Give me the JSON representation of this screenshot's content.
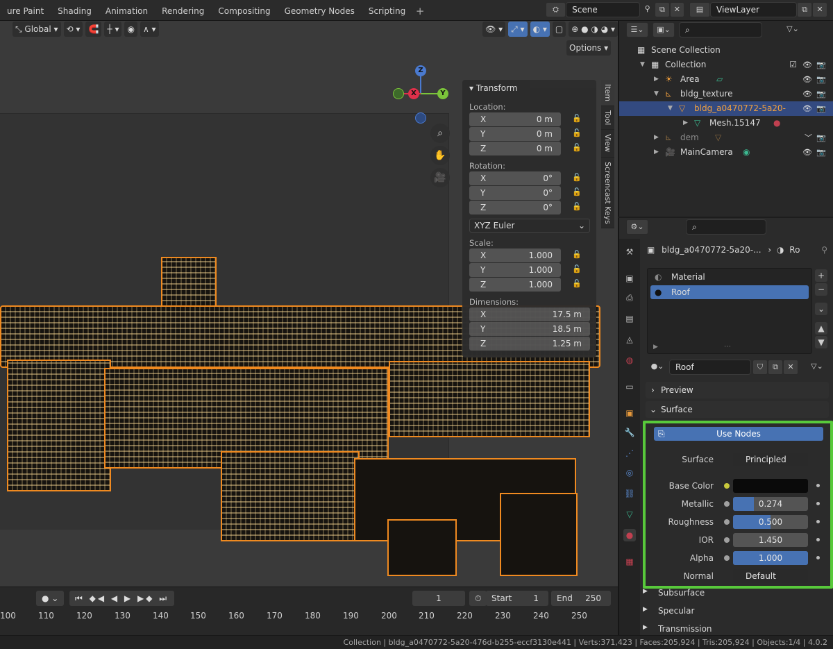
{
  "workspace_tabs": [
    "ure Paint",
    "Shading",
    "Animation",
    "Rendering",
    "Compositing",
    "Geometry Nodes",
    "Scripting"
  ],
  "scene": {
    "name": "Scene"
  },
  "view_layer": {
    "name": "ViewLayer"
  },
  "viewport": {
    "orientation": "Global",
    "options_label": "Options",
    "gizmo": {
      "z": "Z",
      "y": "Y",
      "x": "X"
    },
    "tabs": [
      "Item",
      "Tool",
      "View",
      "Screencast Keys"
    ]
  },
  "transform": {
    "title": "Transform",
    "location_label": "Location:",
    "location": [
      {
        "axis": "X",
        "value": "0 m"
      },
      {
        "axis": "Y",
        "value": "0 m"
      },
      {
        "axis": "Z",
        "value": "0 m"
      }
    ],
    "rotation_label": "Rotation:",
    "rotation": [
      {
        "axis": "X",
        "value": "0°"
      },
      {
        "axis": "Y",
        "value": "0°"
      },
      {
        "axis": "Z",
        "value": "0°"
      }
    ],
    "rotation_mode": "XYZ Euler",
    "scale_label": "Scale:",
    "scale": [
      {
        "axis": "X",
        "value": "1.000"
      },
      {
        "axis": "Y",
        "value": "1.000"
      },
      {
        "axis": "Z",
        "value": "1.000"
      }
    ],
    "dimensions_label": "Dimensions:",
    "dimensions": [
      {
        "axis": "X",
        "value": "17.5 m"
      },
      {
        "axis": "Y",
        "value": "18.5 m"
      },
      {
        "axis": "Z",
        "value": "1.25 m"
      }
    ]
  },
  "timeline": {
    "current_frame": "1",
    "start_label": "Start",
    "start": "1",
    "end_label": "End",
    "end": "250",
    "ticks": [
      "100",
      "110",
      "120",
      "130",
      "140",
      "150",
      "160",
      "170",
      "180",
      "190",
      "200",
      "210",
      "220",
      "230",
      "240",
      "250"
    ]
  },
  "statusbar": {
    "text": "Collection | bldg_a0470772-5a20-476d-b255-eccf3130e441 | Verts:371,423 | Faces:205,924 | Tris:205,924 | Objects:1/4 | 4.0.2"
  },
  "outliner": {
    "items": [
      {
        "label": "Scene Collection"
      },
      {
        "label": "Collection"
      },
      {
        "label": "Area"
      },
      {
        "label": "bldg_texture"
      },
      {
        "label": "bldg_a0470772-5a20-"
      },
      {
        "label": "Mesh.15147"
      },
      {
        "label": "dem"
      },
      {
        "label": "MainCamera"
      }
    ]
  },
  "properties": {
    "object_path": "bldg_a0470772-5a20-...",
    "material_short": "Ro",
    "slots": [
      "Material",
      "Roof"
    ],
    "material_name": "Roof",
    "sections": {
      "preview": "Preview",
      "surface": "Surface"
    },
    "use_nodes_label": "Use Nodes",
    "surface_label": "Surface",
    "surface_shader": "Principled BSDF",
    "params": [
      {
        "label": "Base Color",
        "value": "",
        "fill": 0
      },
      {
        "label": "Metallic",
        "value": "0.274",
        "fill": 0.274
      },
      {
        "label": "Roughness",
        "value": "0.500",
        "fill": 0.5
      },
      {
        "label": "IOR",
        "value": "1.450",
        "fill": 0
      },
      {
        "label": "Alpha",
        "value": "1.000",
        "fill": 1.0
      },
      {
        "label": "Normal",
        "value": "Default",
        "fill": 0
      }
    ],
    "subsections": [
      "Subsurface",
      "Specular",
      "Transmission"
    ]
  },
  "colors": {
    "accent": "#4772b3",
    "selection_outline": "#f08a20",
    "highlight_box": "#58c93b"
  }
}
